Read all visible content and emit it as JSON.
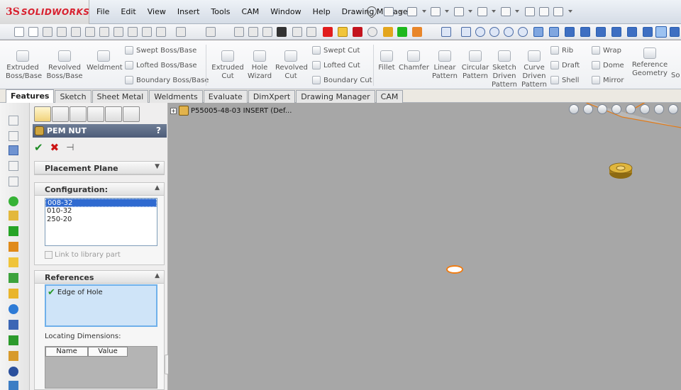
{
  "app": {
    "logo_prefix": "3S",
    "logo_name": "SOLIDWORKS"
  },
  "menus": [
    "File",
    "Edit",
    "View",
    "Insert",
    "Tools",
    "CAM",
    "Window",
    "Help",
    "Drawing Manager"
  ],
  "ribbon": {
    "extruded_boss": "Extruded Boss/Base",
    "revolved_boss": "Revolved Boss/Base",
    "weldment": "Weldment",
    "swept_boss": "Swept Boss/Base",
    "lofted_boss": "Lofted Boss/Base",
    "boundary_boss": "Boundary Boss/Base",
    "extruded_cut": "Extruded Cut",
    "hole_wizard": "Hole Wizard",
    "revolved_cut": "Revolved Cut",
    "swept_cut": "Swept Cut",
    "lofted_cut": "Lofted Cut",
    "boundary_cut": "Boundary Cut",
    "fillet": "Fillet",
    "chamfer": "Chamfer",
    "linear_pattern": "Linear Pattern",
    "circular_pattern": "Circular Pattern",
    "sketch_driven_pattern": "Sketch Driven Pattern",
    "curve_driven_pattern": "Curve Driven Pattern",
    "rib": "Rib",
    "draft": "Draft",
    "shell": "Shell",
    "wrap": "Wrap",
    "dome": "Dome",
    "mirror": "Mirror",
    "reference_geometry": "Reference Geometry",
    "cut_off": "So"
  },
  "tabs": [
    "Features",
    "Sketch",
    "Sheet Metal",
    "Weldments",
    "Evaluate",
    "DimXpert",
    "Drawing Manager",
    "CAM"
  ],
  "property_manager": {
    "title": "PEM NUT",
    "help": "?",
    "placement_plane": "Placement Plane",
    "configuration": "Configuration:",
    "configs": [
      "008-32",
      "010-32",
      "250-20"
    ],
    "link_to_library": "Link to library part",
    "references": "References",
    "edge_of_hole": "Edge of Hole",
    "locating_dimensions": "Locating Dimensions:",
    "col_name": "Name",
    "col_value": "Value"
  },
  "graphics": {
    "tree_label": "P55005-48-03 INSERT  (Def..."
  }
}
